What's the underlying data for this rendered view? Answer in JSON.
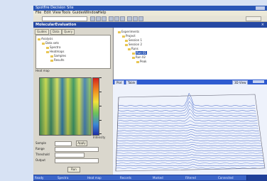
{
  "window": {
    "title": "Spotfire Decision Site",
    "menu": [
      "File",
      "Edit",
      "View",
      "Tools",
      "Guides",
      "Window",
      "Help"
    ],
    "toolbar_value": "",
    "app_title": "MolecularEvaluation"
  },
  "left_panel": {
    "tabs": [
      "Guides",
      "Data",
      "Query"
    ],
    "tree_items": [
      "Analysis",
      "Data sets",
      "Spectra",
      "Heatmaps",
      "Samples",
      "Results"
    ],
    "section_label": "Heat map",
    "scale_label": "Intensity",
    "fields": [
      {
        "label": "Sample",
        "value": ""
      },
      {
        "label": "Range",
        "value": ""
      },
      {
        "label": "Threshold",
        "value": ""
      },
      {
        "label": "Output",
        "value": ""
      }
    ],
    "apply_label": "Apply",
    "run_label": "Run"
  },
  "right_panel": {
    "tree_items": [
      "Experiments",
      "Project",
      "Session 1",
      "Session 2",
      "Runs",
      "Run 01",
      "Run 02",
      "Peak"
    ],
    "highlighted_item": "Run 01",
    "tabs": [
      "Plot",
      "Table"
    ],
    "view_label": "3D View"
  },
  "status_bar": [
    "Ready",
    "Spectra",
    "Heat map",
    "Records",
    "Marked",
    "Filtered",
    "Connected"
  ],
  "colors": {
    "accent": "#2548a3",
    "background": "#d7e2f4"
  }
}
